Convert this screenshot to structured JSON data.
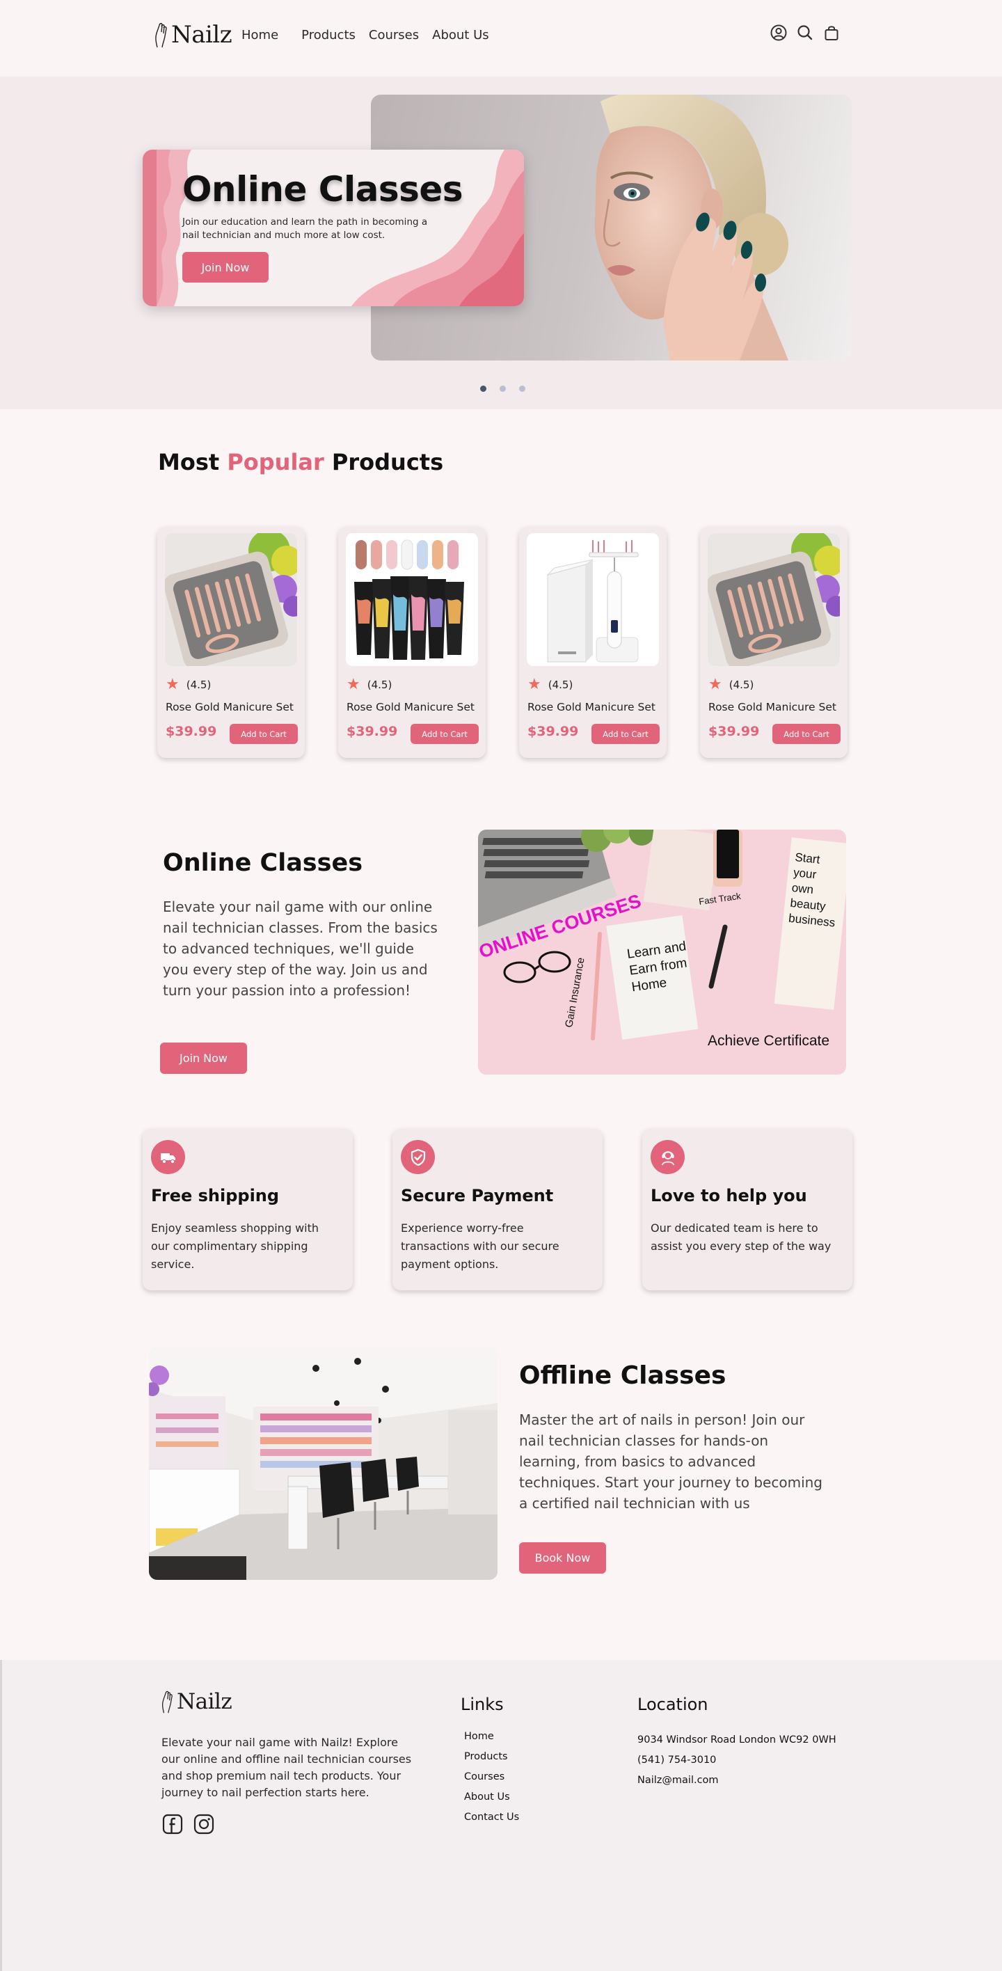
{
  "colors": {
    "accent": "#e2647a",
    "page_bg": "#fcf5f6",
    "hero_bg": "#f3eaeb",
    "card_bg": "#f3eaeb",
    "star": "#f06a5c"
  },
  "nav": {
    "logo": "Nailz",
    "links": [
      "Home",
      "Products",
      "Courses",
      "About Us"
    ],
    "icons": [
      "user-icon",
      "search-icon",
      "shopping-bag-icon"
    ]
  },
  "hero": {
    "title": "Online Classes",
    "description": "Join our education and learn the path in becoming a nail technician and much more at low cost.",
    "button": "Join Now",
    "slides": 3,
    "active_slide": 1
  },
  "popular": {
    "heading_pre": "Most ",
    "heading_accent": "Popular",
    "heading_post": " Products",
    "products": [
      {
        "name": "Rose Gold Manicure Set",
        "rating": "(4.5)",
        "price": "$39.99",
        "button": "Add to Cart",
        "image": "manicure-set"
      },
      {
        "name": "Rose Gold Manicure Set",
        "rating": "(4.5)",
        "price": "$39.99",
        "button": "Add to Cart",
        "image": "polygel-tubes"
      },
      {
        "name": "Rose Gold Manicure Set",
        "rating": "(4.5)",
        "price": "$39.99",
        "button": "Add to Cart",
        "image": "nail-drill"
      },
      {
        "name": "Rose Gold Manicure Set",
        "rating": "(4.5)",
        "price": "$39.99",
        "button": "Add to Cart",
        "image": "manicure-set"
      }
    ]
  },
  "online_classes": {
    "title": "Online Classes",
    "description": "Elevate your nail game with our online nail technician classes. From the basics to advanced techniques, we'll guide you every step of the way. Join us and turn your passion into a profession!",
    "button": "Join Now",
    "image_text": {
      "banner": "ONLINE COURSES",
      "notebook": "Learn and Earn from Home",
      "sticky": "Start your own beauty business",
      "fast_track": "Fast Track",
      "insurance": "Gain Insurance",
      "certificate": "Achieve Certificate"
    }
  },
  "features": [
    {
      "icon": "delivery-truck-icon",
      "title": "Free shipping",
      "description": "Enjoy seamless shopping with our complimentary shipping service."
    },
    {
      "icon": "shield-check-icon",
      "title": "Secure Payment",
      "description": "Experience worry-free transactions with our secure payment options."
    },
    {
      "icon": "support-agent-icon",
      "title": "Love to help you",
      "description": "Our dedicated team is here to assist you every step of the way"
    }
  ],
  "offline_classes": {
    "title": "Offline Classes",
    "description": "Master the art of nails in person! Join our nail technician classes for hands-on learning, from basics to advanced techniques. Start your journey to becoming a certified nail technician with us",
    "button": "Book Now"
  },
  "footer": {
    "logo": "Nailz",
    "about": "Elevate your nail game with Nailz! Explore our online and offline nail technician courses and shop premium nail tech products. Your journey to nail perfection starts here.",
    "social": [
      "facebook-icon",
      "instagram-icon"
    ],
    "links_heading": "Links",
    "links": [
      "Home",
      "Products",
      "Courses",
      "About Us",
      "Contact Us"
    ],
    "location_heading": "Location",
    "address": "9034 Windsor Road London WC92 0WH",
    "phone": "(541) 754-3010",
    "email": "Nailz@mail.com"
  }
}
